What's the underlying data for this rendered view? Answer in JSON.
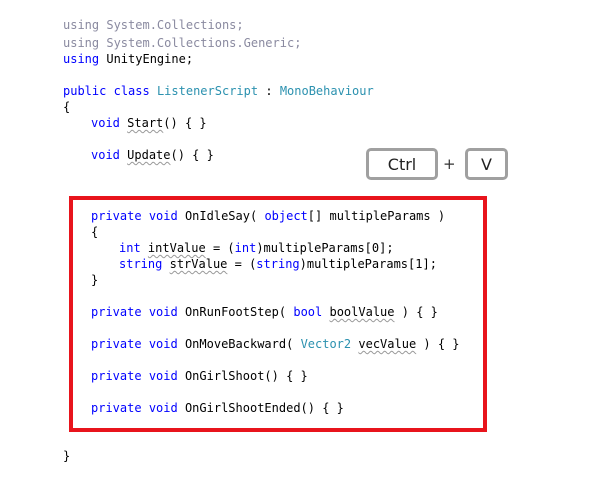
{
  "header_code": {
    "l1": {
      "kw": "using",
      "rest": "System.Collections;"
    },
    "l2": {
      "kw": "using",
      "rest": "System.Collections.Generic;"
    },
    "l3": {
      "kw": "using",
      "rest": "UnityEngine;"
    },
    "l4": {
      "kw1": "public",
      "kw2": "class",
      "name": "ListenerScript",
      "sep": ":",
      "base": "MonoBehaviour"
    },
    "l5": "{",
    "l6": {
      "kw": "void",
      "name": "Start",
      "rest": "() { }"
    },
    "l7": {
      "kw": "void",
      "name": "Update",
      "rest": "() { }"
    }
  },
  "keys": {
    "ctrl": "Ctrl",
    "plus": "+",
    "v": "V"
  },
  "selection": {
    "color": "#e8141c",
    "m1": {
      "kw1": "private",
      "kw2": "void",
      "name": "OnIdleSay(",
      "type": "object",
      "rest": "[] multipleParams )"
    },
    "open": "{",
    "s1": {
      "kw": "int",
      "var": "intValue",
      "eq": " = (",
      "cast": "int",
      "rest": ")multipleParams[0];"
    },
    "s2": {
      "kw": "string",
      "var": "strValue",
      "eq": " = (",
      "cast": "string",
      "rest": ")multipleParams[1];"
    },
    "close": "}",
    "m2": {
      "kw1": "private",
      "kw2": "void",
      "name": "OnRunFootStep(",
      "type": "bool",
      "var": "boolValue",
      "rest": ") { }"
    },
    "m3": {
      "kw1": "private",
      "kw2": "void",
      "name": "OnMoveBackward(",
      "type": "Vector2",
      "var": "vecValue",
      "rest": ") { }"
    },
    "m4": {
      "kw1": "private",
      "kw2": "void",
      "name": "OnGirlShoot() { }"
    },
    "m5": {
      "kw1": "private",
      "kw2": "void",
      "name": "OnGirlShootEnded() { }"
    }
  },
  "footer": "}",
  "colors": {
    "keyword": "#0000ff",
    "type": "#2b91af",
    "dim": "#8a8aa0",
    "frame": "#e8141c",
    "key_border": "#a0a0a0"
  }
}
